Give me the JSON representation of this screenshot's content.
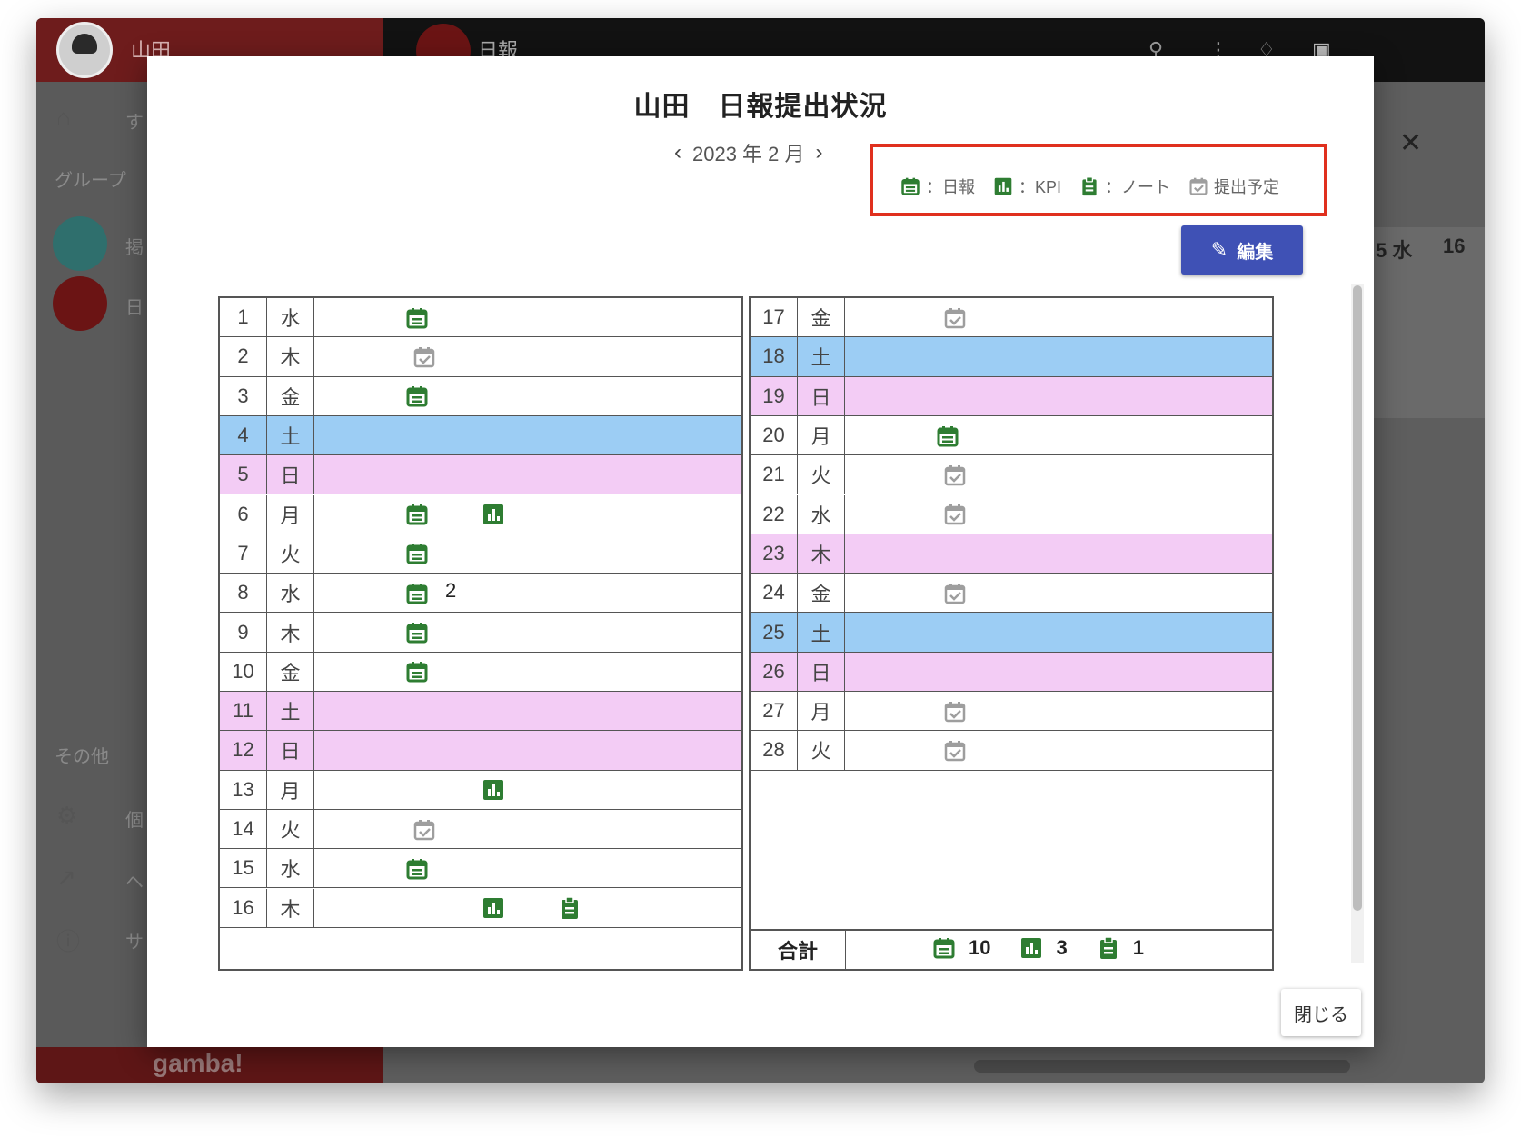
{
  "app": {
    "user_name": "山田",
    "header_title": "日報",
    "sidebar_group_header": "グループ",
    "sidebar_other_header": "その他",
    "sidebar_home_label": "す",
    "sidebar_item1_label": "掲",
    "sidebar_item2_label": "日",
    "sidebar_settings_label": "個",
    "sidebar_external_label": "ヘ",
    "sidebar_help_label": "サ",
    "footer_logo_text": "gamba!",
    "group_logo_text": "gamba!",
    "bg_col_15": "5 水",
    "bg_col_16": "16"
  },
  "modal": {
    "title": "山田　日報提出状況",
    "month_label": "2023 年 2 月",
    "prev_icon": "chevron-left-icon",
    "next_icon": "chevron-right-icon",
    "edit_label": "編集",
    "close_label": "閉じる"
  },
  "legend": {
    "daily": "：日報",
    "kpi": "：KPI",
    "note": "：ノート",
    "scheduled": "提出予定"
  },
  "colors": {
    "daily": "#2e7d32",
    "kpi": "#2e7d32",
    "note": "#2e7d32",
    "scheduled": "#9e9e9e",
    "saturday": "#9ccdf4",
    "sunday": "#f3ccf5",
    "edit_button": "#3f51b5",
    "highlight_box": "#e0301e"
  },
  "days_left": [
    {
      "day": "1",
      "wd": "水",
      "type": "weekday",
      "icons": [
        "daily"
      ],
      "count": ""
    },
    {
      "day": "2",
      "wd": "木",
      "type": "weekday",
      "icons": [
        "scheduled"
      ],
      "count": ""
    },
    {
      "day": "3",
      "wd": "金",
      "type": "weekday",
      "icons": [
        "daily"
      ],
      "count": ""
    },
    {
      "day": "4",
      "wd": "土",
      "type": "sat",
      "icons": [],
      "count": ""
    },
    {
      "day": "5",
      "wd": "日",
      "type": "sun",
      "icons": [],
      "count": ""
    },
    {
      "day": "6",
      "wd": "月",
      "type": "weekday",
      "icons": [
        "daily",
        "kpi"
      ],
      "count": ""
    },
    {
      "day": "7",
      "wd": "火",
      "type": "weekday",
      "icons": [
        "daily"
      ],
      "count": ""
    },
    {
      "day": "8",
      "wd": "水",
      "type": "weekday",
      "icons": [
        "daily"
      ],
      "count": "2"
    },
    {
      "day": "9",
      "wd": "木",
      "type": "weekday",
      "icons": [
        "daily"
      ],
      "count": ""
    },
    {
      "day": "10",
      "wd": "金",
      "type": "weekday",
      "icons": [
        "daily"
      ],
      "count": ""
    },
    {
      "day": "11",
      "wd": "土",
      "type": "sun",
      "icons": [],
      "count": ""
    },
    {
      "day": "12",
      "wd": "日",
      "type": "sun",
      "icons": [],
      "count": ""
    },
    {
      "day": "13",
      "wd": "月",
      "type": "weekday",
      "icons": [
        "kpi"
      ],
      "count": ""
    },
    {
      "day": "14",
      "wd": "火",
      "type": "weekday",
      "icons": [
        "scheduled"
      ],
      "count": ""
    },
    {
      "day": "15",
      "wd": "水",
      "type": "weekday",
      "icons": [
        "daily"
      ],
      "count": ""
    },
    {
      "day": "16",
      "wd": "木",
      "type": "weekday",
      "icons": [
        "kpi",
        "note"
      ],
      "count": ""
    }
  ],
  "days_right": [
    {
      "day": "17",
      "wd": "金",
      "type": "weekday",
      "icons": [
        "scheduled"
      ],
      "count": ""
    },
    {
      "day": "18",
      "wd": "土",
      "type": "sat",
      "icons": [],
      "count": ""
    },
    {
      "day": "19",
      "wd": "日",
      "type": "sun",
      "icons": [],
      "count": ""
    },
    {
      "day": "20",
      "wd": "月",
      "type": "weekday",
      "icons": [
        "daily"
      ],
      "count": ""
    },
    {
      "day": "21",
      "wd": "火",
      "type": "weekday",
      "icons": [
        "scheduled"
      ],
      "count": ""
    },
    {
      "day": "22",
      "wd": "水",
      "type": "weekday",
      "icons": [
        "scheduled"
      ],
      "count": ""
    },
    {
      "day": "23",
      "wd": "木",
      "type": "sun",
      "icons": [],
      "count": ""
    },
    {
      "day": "24",
      "wd": "金",
      "type": "weekday",
      "icons": [
        "scheduled"
      ],
      "count": ""
    },
    {
      "day": "25",
      "wd": "土",
      "type": "sat",
      "icons": [],
      "count": ""
    },
    {
      "day": "26",
      "wd": "日",
      "type": "sun",
      "icons": [],
      "count": ""
    },
    {
      "day": "27",
      "wd": "月",
      "type": "weekday",
      "icons": [
        "scheduled"
      ],
      "count": ""
    },
    {
      "day": "28",
      "wd": "火",
      "type": "weekday",
      "icons": [
        "scheduled"
      ],
      "count": ""
    }
  ],
  "totals": {
    "label": "合計",
    "daily": "10",
    "kpi": "3",
    "note": "1"
  }
}
